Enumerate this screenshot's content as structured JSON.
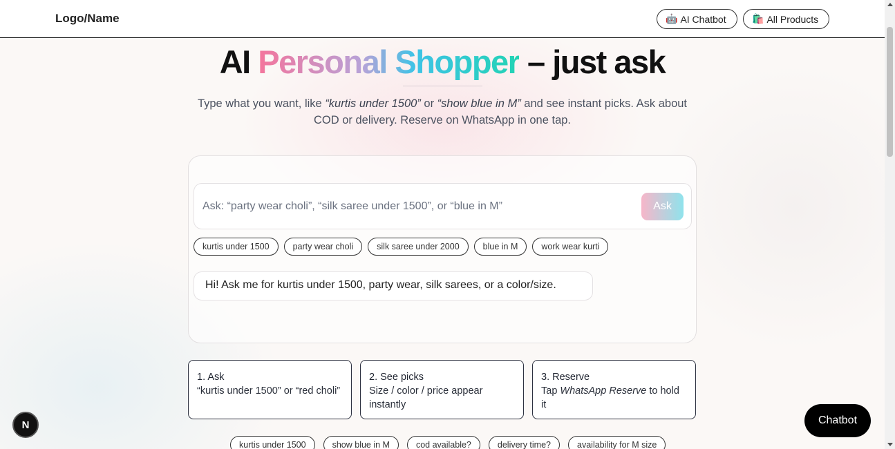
{
  "header": {
    "logo": "Logo/Name",
    "nav": [
      {
        "icon": "🤖",
        "label": "AI Chatbot"
      },
      {
        "icon": "🛍️",
        "label": "All Products"
      }
    ]
  },
  "hero": {
    "title_start": "AI ",
    "title_gradient": "Personal Shopper",
    "title_end": " – just ask",
    "subtitle_pre": "Type what you want, like ",
    "subtitle_example1": "“kurtis under 1500”",
    "subtitle_mid": " or ",
    "subtitle_example2": "“show blue in M”",
    "subtitle_post": " and see instant picks. Ask about COD or delivery. Reserve on WhatsApp in one tap."
  },
  "chat": {
    "input_placeholder": "Ask: “party wear choli”, “silk saree under 1500”, or “blue in M”",
    "input_value": "",
    "ask_label": "Ask",
    "chips": [
      "kurtis under 1500",
      "party wear choli",
      "silk saree under 2000",
      "blue in M",
      "work wear kurti"
    ],
    "bot_message": "Hi! Ask me for kurtis under 1500, party wear, silk sarees, or a color/size."
  },
  "steps": [
    {
      "title": "1. Ask",
      "text": "“kurtis under 1500” or “red choli”"
    },
    {
      "title": "2. See picks",
      "text": "Size / color / price appear instantly"
    },
    {
      "title": "3. Reserve",
      "text_pre": "Tap ",
      "text_em": "WhatsApp Reserve",
      "text_post": " to hold it"
    }
  ],
  "bottom_chips": [
    "kurtis under 1500",
    "show blue in M",
    "cod available?",
    "delivery time?",
    "availability for M size"
  ],
  "floating": {
    "badge": "N",
    "chatbot_label": "Chatbot"
  },
  "colors": {
    "gradient_start": "#f4759c",
    "gradient_mid": "#b7a2d8",
    "gradient_blue": "#3fc3e6",
    "gradient_end": "#22d3b4"
  }
}
